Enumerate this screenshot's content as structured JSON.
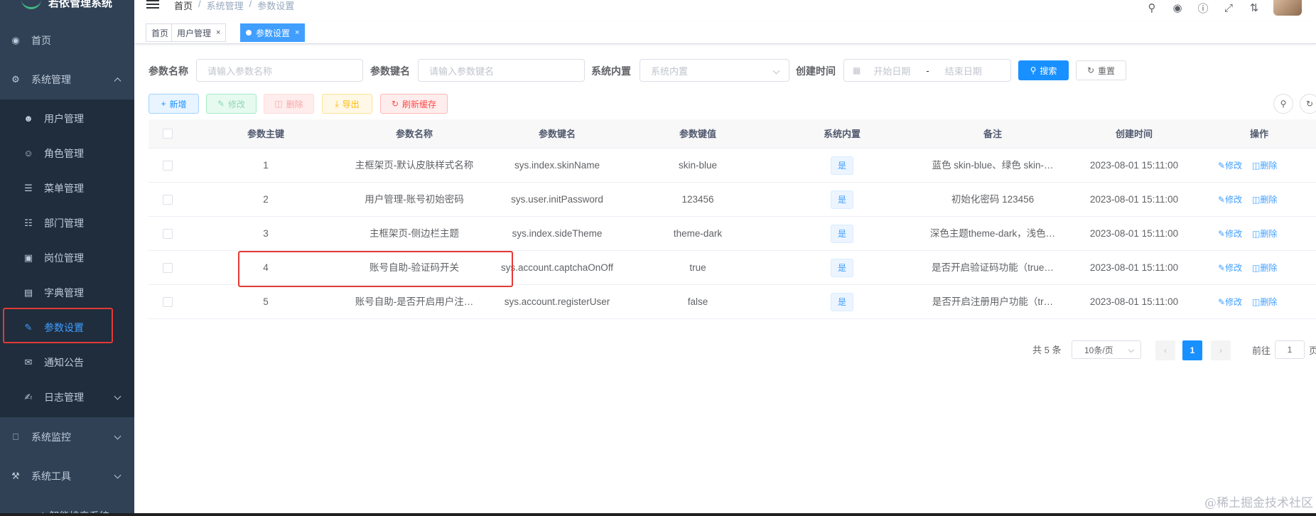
{
  "app": {
    "title": "若依管理系统"
  },
  "sidebar": {
    "items": [
      {
        "label": "首页",
        "icon": "dashboard-icon"
      },
      {
        "label": "系统管理",
        "icon": "gear-icon"
      },
      {
        "label": "用户管理",
        "icon": "user-icon"
      },
      {
        "label": "角色管理",
        "icon": "peoples-icon"
      },
      {
        "label": "菜单管理",
        "icon": "tree-table-icon"
      },
      {
        "label": "部门管理",
        "icon": "tree-icon"
      },
      {
        "label": "岗位管理",
        "icon": "post-icon"
      },
      {
        "label": "字典管理",
        "icon": "dict-icon"
      },
      {
        "label": "参数设置",
        "icon": "edit-icon"
      },
      {
        "label": "通知公告",
        "icon": "message-icon"
      },
      {
        "label": "日志管理",
        "icon": "log-icon"
      },
      {
        "label": "系统监控",
        "icon": "monitor-icon"
      },
      {
        "label": "系统工具",
        "icon": "tool-icon"
      },
      {
        "label": "zoin智能排产系统",
        "icon": "guide-icon"
      }
    ]
  },
  "navbar": {
    "breadcrumb": [
      "首页",
      "系统管理",
      "参数设置"
    ]
  },
  "tags": [
    "首页",
    "用户管理",
    "参数设置"
  ],
  "search": {
    "config_name_label": "参数名称",
    "config_name_placeholder": "请输入参数名称",
    "config_key_label": "参数键名",
    "config_key_placeholder": "请输入参数键名",
    "config_type_label": "系统内置",
    "config_type_placeholder": "系统内置",
    "date_label": "创建时间",
    "date_start": "开始日期",
    "date_sep": "-",
    "date_end": "结束日期",
    "search_btn": "搜索",
    "reset_btn": "重置"
  },
  "toolbar": {
    "add": "新增",
    "edit": "修改",
    "delete": "删除",
    "export": "导出",
    "refresh_cache": "刷新缓存"
  },
  "table": {
    "headers": [
      "参数主键",
      "参数名称",
      "参数键名",
      "参数键值",
      "系统内置",
      "备注",
      "创建时间",
      "操作"
    ],
    "rows": [
      {
        "id": "1",
        "name": "主框架页-默认皮肤样式名称",
        "key": "sys.index.skinName",
        "value": "skin-blue",
        "builtin": "是",
        "remark": "蓝色 skin-blue、绿色 skin-…",
        "created": "2023-08-01 15:11:00"
      },
      {
        "id": "2",
        "name": "用户管理-账号初始密码",
        "key": "sys.user.initPassword",
        "value": "123456",
        "builtin": "是",
        "remark": "初始化密码 123456",
        "created": "2023-08-01 15:11:00"
      },
      {
        "id": "3",
        "name": "主框架页-侧边栏主题",
        "key": "sys.index.sideTheme",
        "value": "theme-dark",
        "builtin": "是",
        "remark": "深色主题theme-dark，浅色…",
        "created": "2023-08-01 15:11:00"
      },
      {
        "id": "4",
        "name": "账号自助-验证码开关",
        "key": "sys.account.captchaOnOff",
        "value": "true",
        "builtin": "是",
        "remark": "是否开启验证码功能（true…",
        "created": "2023-08-01 15:11:00"
      },
      {
        "id": "5",
        "name": "账号自助-是否开启用户注…",
        "key": "sys.account.registerUser",
        "value": "false",
        "builtin": "是",
        "remark": "是否开启注册用户功能（tr…",
        "created": "2023-08-01 15:11:00"
      }
    ],
    "op_edit": "修改",
    "op_delete": "删除"
  },
  "pagination": {
    "total": "共 5 条",
    "page_size": "10条/页",
    "current": "1",
    "goto_label": "前往",
    "goto_value": "1",
    "page_suffix": "页"
  },
  "watermark": "@稀土掘金技术社区",
  "colors": {
    "sidebar_bg": "#304156",
    "submenu_bg": "#1f2d3d",
    "primary": "#1890ff",
    "highlight": "#e53935"
  }
}
